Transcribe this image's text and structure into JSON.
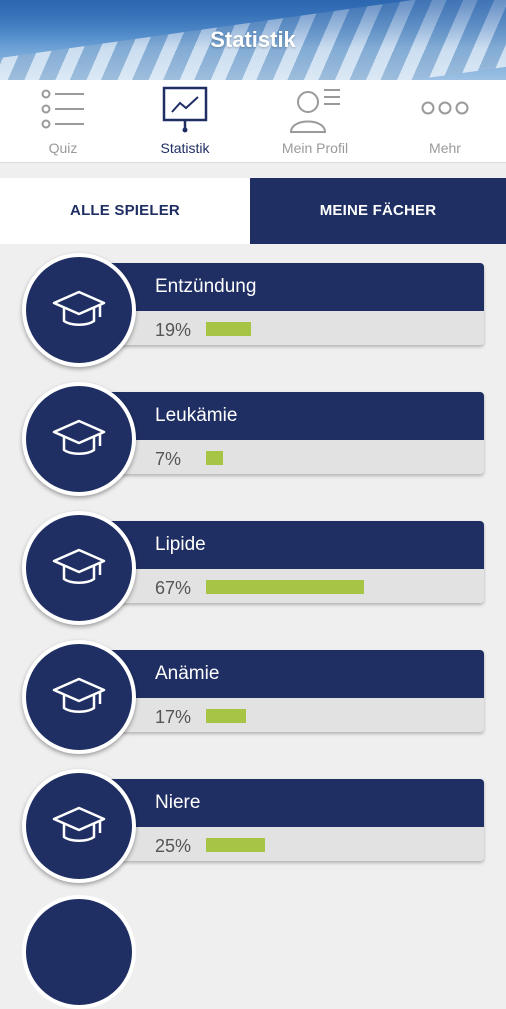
{
  "header": {
    "title": "Statistik"
  },
  "nav": [
    {
      "label": "Quiz",
      "icon": "list-icon"
    },
    {
      "label": "Statistik",
      "icon": "chart-board-icon",
      "active": true
    },
    {
      "label": "Mein Profil",
      "icon": "profile-icon"
    },
    {
      "label": "Mehr",
      "icon": "more-icon"
    }
  ],
  "tabs": {
    "all_players": "ALLE SPIELER",
    "my_subjects": "MEINE FÄCHER",
    "selected": "my_subjects"
  },
  "subjects": [
    {
      "name": "Entzündung",
      "percent_label": "19%",
      "percent": 19,
      "icon": "graduation-cap-icon"
    },
    {
      "name": "Leukämie",
      "percent_label": "7%",
      "percent": 7,
      "icon": "graduation-cap-icon"
    },
    {
      "name": "Lipide",
      "percent_label": "67%",
      "percent": 67,
      "icon": "graduation-cap-icon"
    },
    {
      "name": "Anämie",
      "percent_label": "17%",
      "percent": 17,
      "icon": "graduation-cap-icon"
    },
    {
      "name": "Niere",
      "percent_label": "25%",
      "percent": 25,
      "icon": "graduation-cap-icon"
    }
  ],
  "colors": {
    "primary": "#1f2f63",
    "progress": "#a6c545",
    "track": "#e2e2e2"
  }
}
